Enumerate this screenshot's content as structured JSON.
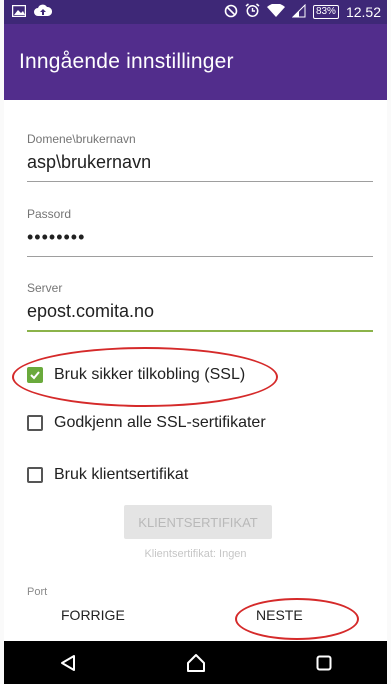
{
  "status_bar": {
    "battery": "83%",
    "time": "12.52",
    "left_icons": [
      "image-icon",
      "cloud-upload-icon"
    ],
    "right_icons": [
      "do-not-disturb-icon",
      "alarm-icon",
      "wifi-icon",
      "signal-icon"
    ]
  },
  "app_bar": {
    "title": "Inngående innstillinger"
  },
  "form": {
    "domain_username": {
      "label": "Domene\\brukernavn",
      "value": "asp\\brukernavn"
    },
    "password": {
      "label": "Passord",
      "value": "••••••••"
    },
    "server": {
      "label": "Server",
      "value": "epost.comita.no"
    },
    "ssl": {
      "label": "Bruk sikker tilkobling (SSL)",
      "checked": true
    },
    "accept_all_ssl": {
      "label": "Godkjenn alle SSL-sertifikater",
      "checked": false
    },
    "client_cert": {
      "label": "Bruk klientsertifikat",
      "checked": false
    },
    "client_cert_button": "KLIENTSERTIFIKAT",
    "client_cert_status": "Klientsertifikat: Ingen",
    "port_label": "Port"
  },
  "bottom": {
    "previous": "FORRIGE",
    "next": "NESTE"
  },
  "colors": {
    "app_bar": "#522d8c",
    "status_bar": "#3e2877",
    "accent": "#6aaa3c",
    "annotation": "#d52a2a"
  }
}
